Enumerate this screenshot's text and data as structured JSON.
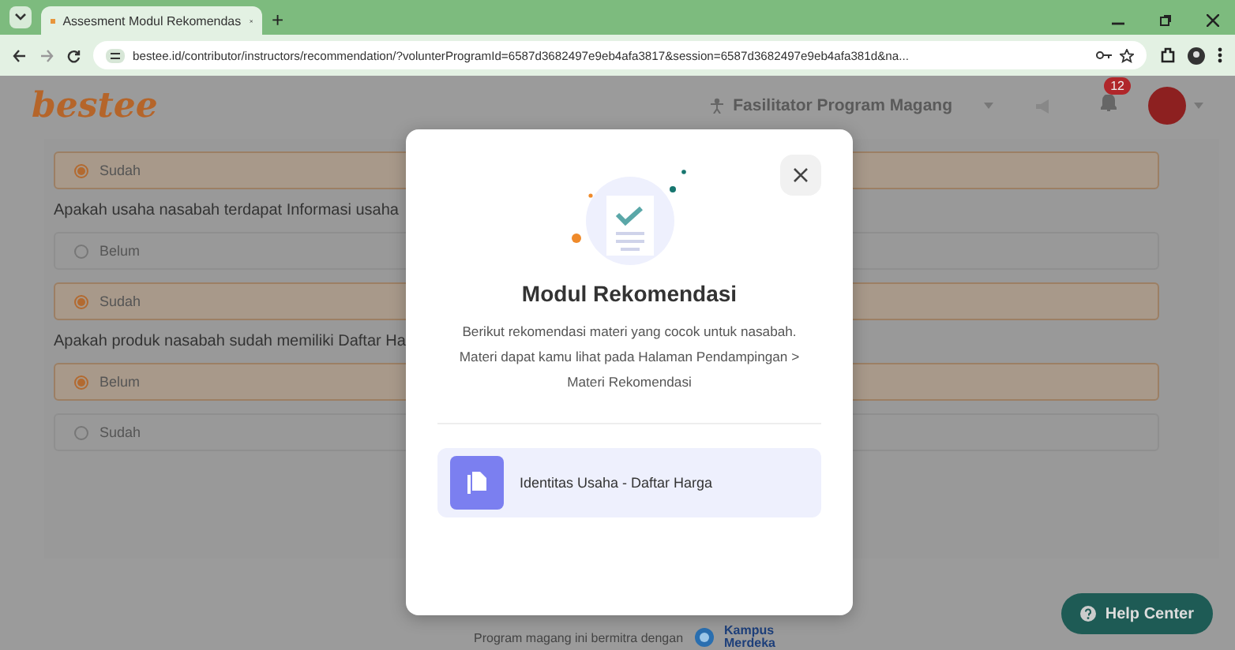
{
  "browser": {
    "tab_title": "Assesment Modul Rekomendas",
    "new_tab": "+",
    "url": "bestee.id/contributor/instructors/recommendation/?volunterProgramId=6587d3682497e9eb4afa3817&session=6587d3682497e9eb4afa381d&na..."
  },
  "header": {
    "logo": "bestee",
    "role": "Fasilitator Program Magang",
    "notification_count": "12"
  },
  "questions": [
    {
      "options": [
        {
          "label": "Sudah",
          "selected": true
        }
      ]
    },
    {
      "text": "Apakah usaha nasabah terdapat Informasi usaha",
      "options": [
        {
          "label": "Belum",
          "selected": false
        },
        {
          "label": "Sudah",
          "selected": true
        }
      ]
    },
    {
      "text": "Apakah produk nasabah sudah memiliki Daftar Ha",
      "options": [
        {
          "label": "Belum",
          "selected": true
        },
        {
          "label": "Sudah",
          "selected": false
        }
      ]
    }
  ],
  "footer": {
    "text": "Program magang ini bermitra dengan",
    "partner_line_1": "Kampus",
    "partner_line_2": "Merdeka"
  },
  "help_button": "Help Center",
  "modal": {
    "title": "Modul Rekomendasi",
    "description": "Berikut rekomendasi materi yang cocok untuk nasabah. Materi dapat kamu lihat pada Halaman Pendampingan > Materi Rekomendasi",
    "items": [
      {
        "label": "Identitas Usaha - Daftar Harga"
      }
    ]
  }
}
